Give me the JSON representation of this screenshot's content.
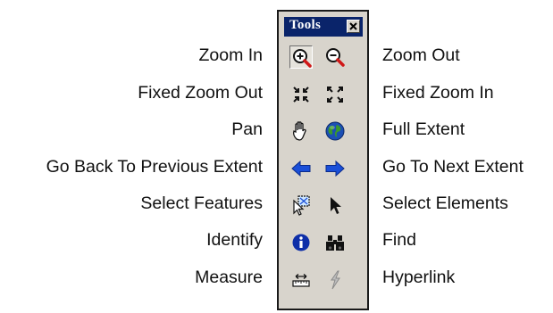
{
  "toolbar": {
    "title": "Tools",
    "close_icon": "close-x-icon"
  },
  "tools": [
    {
      "left": "Zoom In",
      "right": "Zoom Out",
      "left_icon": "zoom-in-icon",
      "right_icon": "zoom-out-icon"
    },
    {
      "left": "Fixed Zoom Out",
      "right": "Fixed Zoom In",
      "left_icon": "fixed-zoom-out-icon",
      "right_icon": "fixed-zoom-in-icon"
    },
    {
      "left": "Pan",
      "right": "Full Extent",
      "left_icon": "hand-icon",
      "right_icon": "globe-icon"
    },
    {
      "left": "Go Back To Previous Extent",
      "right": "Go To Next Extent",
      "left_icon": "arrow-left-icon",
      "right_icon": "arrow-right-icon"
    },
    {
      "left": "Select Features",
      "right": "Select Elements",
      "left_icon": "select-features-icon",
      "right_icon": "cursor-arrow-icon"
    },
    {
      "left": "Identify",
      "right": "Find",
      "left_icon": "info-icon",
      "right_icon": "binoculars-icon"
    },
    {
      "left": "Measure",
      "right": "Hyperlink",
      "left_icon": "measure-icon",
      "right_icon": "lightning-icon"
    }
  ],
  "colors": {
    "title_bar": "#0a246a",
    "toolbar_bg": "#d8d4cc",
    "arrow_blue": "#1a4fd8",
    "zoom_red": "#d01818"
  }
}
